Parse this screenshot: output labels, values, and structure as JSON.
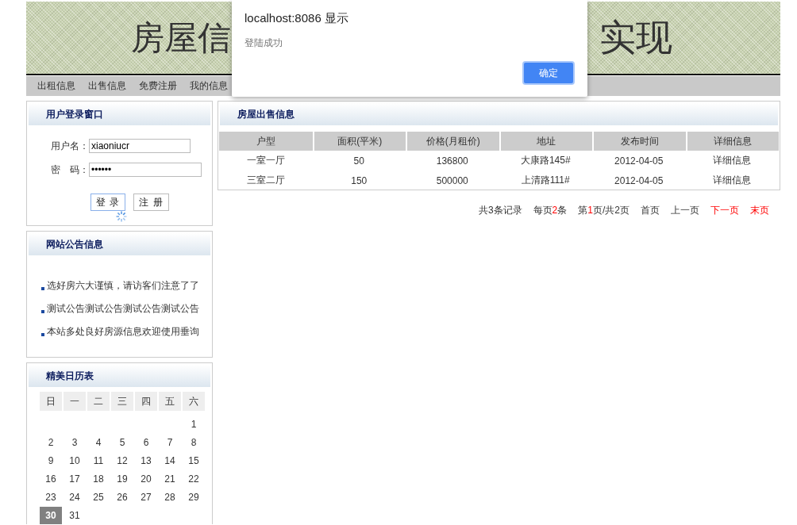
{
  "banner": {
    "title_left": "房屋信",
    "title_right": "实现"
  },
  "nav": {
    "items": [
      "出租信息",
      "出售信息",
      "免费注册",
      "我的信息"
    ]
  },
  "login": {
    "title": "用户登录窗口",
    "fields": [
      {
        "label": "用户名：",
        "value": "xiaoniucr"
      },
      {
        "label": "密　码：",
        "value": "••••••"
      }
    ],
    "buttons": [
      {
        "label": "登 录",
        "focused": true
      },
      {
        "label": "注 册",
        "focused": false
      }
    ],
    "loading": true
  },
  "notices": {
    "title": "网站公告信息",
    "items": [
      "选好房六大谨慎，请访客们注意了了",
      "测试公告测试公告测试公告测试公告",
      "本站多处良好房源信息欢迎使用垂询"
    ]
  },
  "calendar": {
    "title": "精美日历表",
    "weekdays": [
      "日",
      "一",
      "二",
      "三",
      "四",
      "五",
      "六"
    ],
    "weeks": [
      [
        {
          "kind": "blank"
        },
        {
          "kind": "blank"
        },
        {
          "kind": "blank"
        },
        {
          "kind": "blank"
        },
        {
          "kind": "blank"
        },
        {
          "kind": "blank"
        },
        {
          "kind": "day",
          "day": "1",
          "selected": false
        }
      ],
      [
        {
          "kind": "day",
          "day": "2",
          "selected": false
        },
        {
          "kind": "day",
          "day": "3",
          "selected": false
        },
        {
          "kind": "day",
          "day": "4",
          "selected": false
        },
        {
          "kind": "day",
          "day": "5",
          "selected": false
        },
        {
          "kind": "day",
          "day": "6",
          "selected": false
        },
        {
          "kind": "day",
          "day": "7",
          "selected": false
        },
        {
          "kind": "day",
          "day": "8",
          "selected": false
        }
      ],
      [
        {
          "kind": "day",
          "day": "9",
          "selected": false
        },
        {
          "kind": "day",
          "day": "10",
          "selected": false
        },
        {
          "kind": "day",
          "day": "11",
          "selected": false
        },
        {
          "kind": "day",
          "day": "12",
          "selected": false
        },
        {
          "kind": "day",
          "day": "13",
          "selected": false
        },
        {
          "kind": "day",
          "day": "14",
          "selected": false
        },
        {
          "kind": "day",
          "day": "15",
          "selected": false
        }
      ],
      [
        {
          "kind": "day",
          "day": "16",
          "selected": false
        },
        {
          "kind": "day",
          "day": "17",
          "selected": false
        },
        {
          "kind": "day",
          "day": "18",
          "selected": false
        },
        {
          "kind": "day",
          "day": "19",
          "selected": false
        },
        {
          "kind": "day",
          "day": "20",
          "selected": false
        },
        {
          "kind": "day",
          "day": "21",
          "selected": false
        },
        {
          "kind": "day",
          "day": "22",
          "selected": false
        }
      ],
      [
        {
          "kind": "day",
          "day": "23",
          "selected": false
        },
        {
          "kind": "day",
          "day": "24",
          "selected": false
        },
        {
          "kind": "day",
          "day": "25",
          "selected": false
        },
        {
          "kind": "day",
          "day": "26",
          "selected": false
        },
        {
          "kind": "day",
          "day": "27",
          "selected": false
        },
        {
          "kind": "day",
          "day": "28",
          "selected": false
        },
        {
          "kind": "day",
          "day": "29",
          "selected": false
        }
      ],
      [
        {
          "kind": "day",
          "day": "30",
          "selected": true
        },
        {
          "kind": "day",
          "day": "31",
          "selected": false
        }
      ]
    ]
  },
  "listings": {
    "title": "房屋出售信息",
    "columns": [
      "户型",
      "面积(平米)",
      "价格(月租价)",
      "地址",
      "发布时间",
      "详细信息"
    ],
    "rows": [
      [
        "一室一厅",
        "50",
        "136800",
        "大康路145#",
        "2012-04-05",
        "详细信息"
      ],
      [
        "三室二厅",
        "150",
        "500000",
        "上清路111#",
        "2012-04-05",
        "详细信息"
      ]
    ]
  },
  "pager": {
    "summary": [
      [
        {
          "text": "共3条记录",
          "highlight": false
        }
      ],
      [
        {
          "text": "每页",
          "highlight": false
        },
        {
          "text": "2",
          "highlight": true
        },
        {
          "text": "条",
          "highlight": false
        }
      ],
      [
        {
          "text": "第",
          "highlight": false
        },
        {
          "text": "1",
          "highlight": true
        },
        {
          "text": "页/共2页",
          "highlight": false
        }
      ]
    ],
    "links": [
      {
        "label": "首页",
        "disabled": true
      },
      {
        "label": "上一页",
        "disabled": true
      },
      {
        "label": "下一页",
        "disabled": false
      },
      {
        "label": "末页",
        "disabled": false
      }
    ]
  },
  "dialog": {
    "title": "localhost:8086 显示",
    "message": "登陆成功",
    "button": "确定"
  }
}
